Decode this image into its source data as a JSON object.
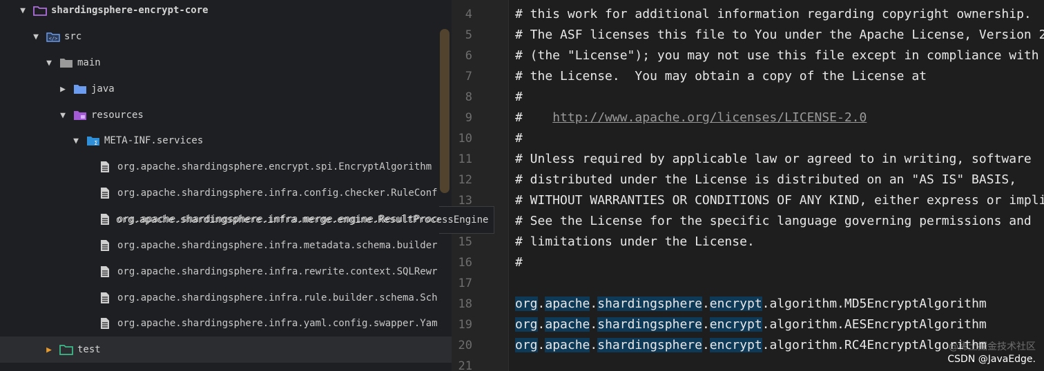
{
  "tree": {
    "items": [
      {
        "label": "shardingsphere-encrypt-core",
        "arrow": "▼",
        "icon": "module-folder-icon"
      },
      {
        "label": "src",
        "arrow": "▼",
        "icon": "source-folder-icon"
      },
      {
        "label": "main",
        "arrow": "▼",
        "icon": "folder-icon"
      },
      {
        "label": "java",
        "arrow": "▶",
        "icon": "java-folder-icon"
      },
      {
        "label": "resources",
        "arrow": "▼",
        "icon": "resources-folder-icon"
      },
      {
        "label": "META-INF.services",
        "arrow": "▼",
        "icon": "services-folder-icon"
      },
      {
        "label": "org.apache.shardingsphere.encrypt.spi.EncryptAlgorithm",
        "icon": "file-icon"
      },
      {
        "label": "org.apache.shardingsphere.infra.config.checker.RuleConf",
        "icon": "file-icon"
      },
      {
        "label": "org.apache.shardingsphere.infra.merge.engine.ResultProcessEngine",
        "icon": "file-icon"
      },
      {
        "label": "org.apache.shardingsphere.infra.metadata.schema.builder",
        "icon": "file-icon"
      },
      {
        "label": "org.apache.shardingsphere.infra.rewrite.context.SQLRewr",
        "icon": "file-icon"
      },
      {
        "label": "org.apache.shardingsphere.infra.rule.builder.schema.Sch",
        "icon": "file-icon"
      },
      {
        "label": "org.apache.shardingsphere.infra.yaml.config.swapper.Yam",
        "icon": "file-icon"
      },
      {
        "label": "test",
        "arrow": "▶",
        "icon": "test-folder-icon"
      }
    ],
    "tooltip": "org.apache.shardingsphere.infra.merge.engine.ResultProcessEngine"
  },
  "editor": {
    "line_numbers": [
      "4",
      "5",
      "6",
      "7",
      "8",
      "9",
      "10",
      "11",
      "12",
      "13",
      "14",
      "15",
      "16",
      "17",
      "18",
      "19",
      "20",
      "21"
    ],
    "lines": [
      "# this work for additional information regarding copyright ownership.",
      "# The ASF licenses this file to You under the Apache License, Version 2",
      "# (the \"License\"); you may not use this file except in compliance with",
      "# the License.  You may obtain a copy of the License at",
      "#",
      "#",
      "#",
      "# Unless required by applicable law or agreed to in writing, software",
      "# distributed under the License is distributed on an \"AS IS\" BASIS,",
      "# WITHOUT WARRANTIES OR CONDITIONS OF ANY KIND, either express or impli",
      "# See the License for the specific language governing permissions and",
      "# limitations under the License.",
      "#",
      ""
    ],
    "link_text": "http://www.apache.org/licenses/LICENSE-2.0",
    "class_lines": [
      {
        "org": "org",
        "apache": "apache",
        "ss": "shardingsphere",
        "enc": "encrypt",
        "rest": ".algorithm.MD5EncryptAlgorithm"
      },
      {
        "org": "org",
        "apache": "apache",
        "ss": "shardingsphere",
        "enc": "encrypt",
        "rest": ".algorithm.AESEncryptAlgorithm"
      },
      {
        "org": "org",
        "apache": "apache",
        "ss": "shardingsphere",
        "enc": "encrypt",
        "rest": ".algorithm.RC4EncryptAlgorithm"
      }
    ]
  },
  "watermark": {
    "line1": "@稀土掘金技术社区",
    "line2": "CSDN @JavaEdge."
  },
  "colors": {
    "highlight": "#0f3a57",
    "module_folder": "#b06ee0",
    "java_folder": "#6b9cf0",
    "resources_folder": "#a45ad6",
    "services_folder": "#2f8fd8",
    "test_folder": "#3fb98a",
    "scroll_thumb": "#5b4a2f"
  }
}
